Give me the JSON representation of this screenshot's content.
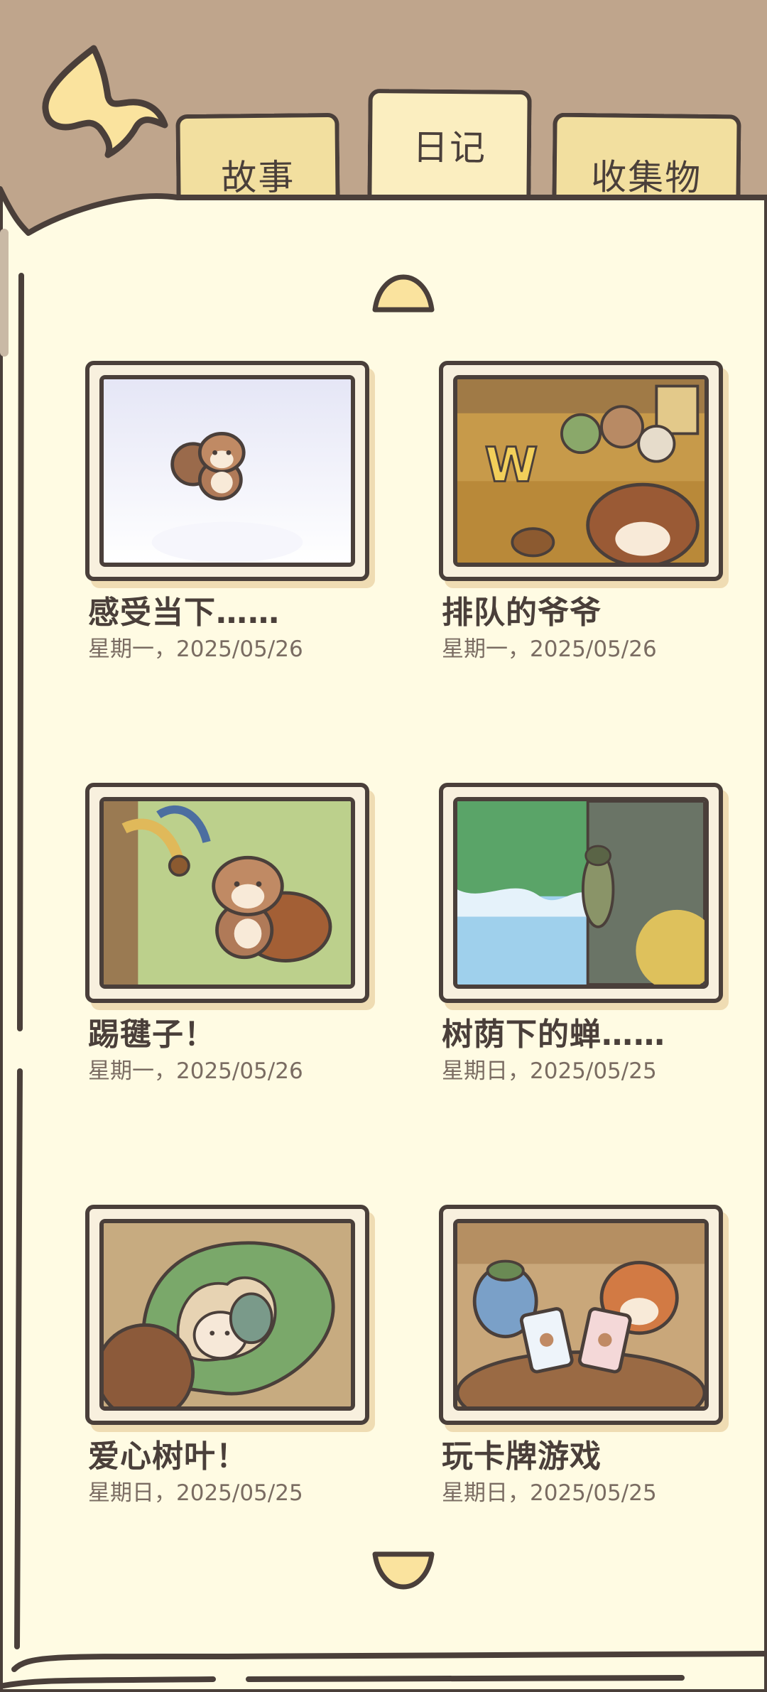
{
  "tabs": [
    {
      "label": "故事",
      "active": false
    },
    {
      "label": "日记",
      "active": true
    },
    {
      "label": "收集物",
      "active": false
    }
  ],
  "colors": {
    "background_brown": "#bfa58c",
    "page_cream": "#fffbe3",
    "outline": "#4a3f3a",
    "tab_yellow": "#f2df9f",
    "arrow_yellow": "#fae39e"
  },
  "entries": [
    {
      "title": "感受当下……",
      "date": "星期一，2025/05/26",
      "illustration": "squirrel-sitting-snow"
    },
    {
      "title": "排队的爷爷",
      "date": "星期一，2025/05/26",
      "illustration": "queue-at-burger-shop"
    },
    {
      "title": "踢毽子！",
      "date": "星期一，2025/05/26",
      "illustration": "squirrel-kicking-shuttlecock"
    },
    {
      "title": "树荫下的蝉……",
      "date": "星期日，2025/05/25",
      "illustration": "cicada-on-tree"
    },
    {
      "title": "爱心树叶！",
      "date": "星期日，2025/05/25",
      "illustration": "hedgehog-in-heart-leaf"
    },
    {
      "title": "玩卡牌游戏",
      "date": "星期日，2025/05/25",
      "illustration": "playing-card-game"
    }
  ],
  "icons": {
    "back": "back-arrow-icon",
    "page_up": "page-up-arrow-icon",
    "page_down": "page-down-arrow-icon"
  }
}
